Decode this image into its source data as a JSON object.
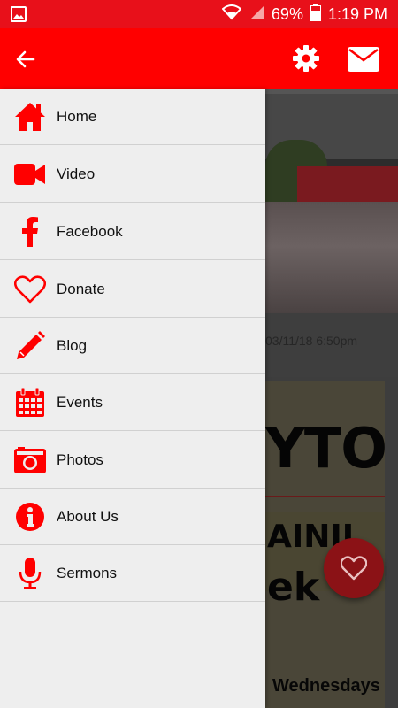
{
  "status_bar": {
    "battery": "69%",
    "time": "1:19 PM",
    "icons": [
      "image-icon",
      "wifi-icon",
      "signal-icon",
      "battery-icon"
    ]
  },
  "app_bar": {
    "icons": [
      "back-arrow-icon",
      "gear-icon",
      "mail-icon"
    ],
    "color": "#ff0000"
  },
  "menu": {
    "items": [
      {
        "label": "Home",
        "icon": "home-icon"
      },
      {
        "label": "Video",
        "icon": "video-camera-icon"
      },
      {
        "label": "Facebook",
        "icon": "facebook-icon"
      },
      {
        "label": "Donate",
        "icon": "heart-icon"
      },
      {
        "label": "Blog",
        "icon": "pencil-icon"
      },
      {
        "label": "Events",
        "icon": "calendar-icon"
      },
      {
        "label": "Photos",
        "icon": "camera-icon"
      },
      {
        "label": "About Us",
        "icon": "info-icon"
      },
      {
        "label": "Sermons",
        "icon": "microphone-icon"
      }
    ],
    "icon_color": "#ff0000"
  },
  "background": {
    "post_date": "03/11/18 6:50pm",
    "card_headline_1": "YTO",
    "card_headline_2": "AINII",
    "card_headline_3": "ek",
    "card_footer": "Wednesdays"
  },
  "fab": {
    "icon": "heart-outline-icon"
  }
}
